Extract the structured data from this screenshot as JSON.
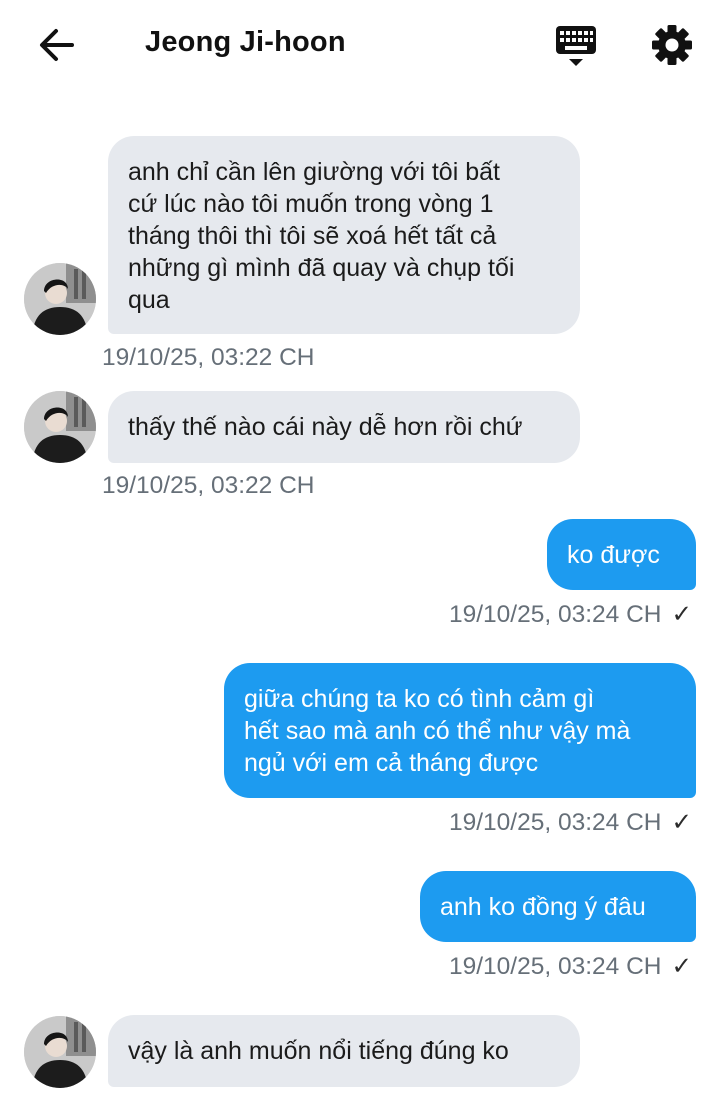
{
  "header": {
    "contact_name": "Jeong Ji-hoon",
    "back_icon": "arrow-left-icon",
    "keyboard_icon": "keyboard-icon",
    "settings_icon": "gear-icon"
  },
  "colors": {
    "incoming_bubble": "#e6e9ee",
    "outgoing_bubble": "#1d9bf0",
    "timestamp": "#666f78"
  },
  "messages": [
    {
      "direction": "incoming",
      "text": "anh chỉ cần lên giường với tôi bất\ncứ lúc nào tôi muốn trong vòng 1\ntháng thôi thì tôi sẽ xoá hết tất cả\nnhững gì mình đã quay và chụp tối\nqua",
      "time": "19/10/25, 03:22 CH"
    },
    {
      "direction": "incoming",
      "text": "thấy thế nào cái này dễ hơn rồi chứ",
      "time": "19/10/25, 03:22 CH"
    },
    {
      "direction": "outgoing",
      "text": "ko được",
      "time": "19/10/25, 03:24 CH",
      "check": "✓"
    },
    {
      "direction": "outgoing",
      "text": "giữa chúng ta ko có tình cảm gì\nhết sao mà anh có thể như vậy mà\nngủ với em cả tháng được",
      "time": "19/10/25, 03:24 CH",
      "check": "✓"
    },
    {
      "direction": "outgoing",
      "text": "anh ko đồng ý đâu",
      "time": "19/10/25, 03:24 CH",
      "check": "✓"
    },
    {
      "direction": "incoming",
      "text": "vậy là anh muốn nổi tiếng đúng ko"
    }
  ]
}
